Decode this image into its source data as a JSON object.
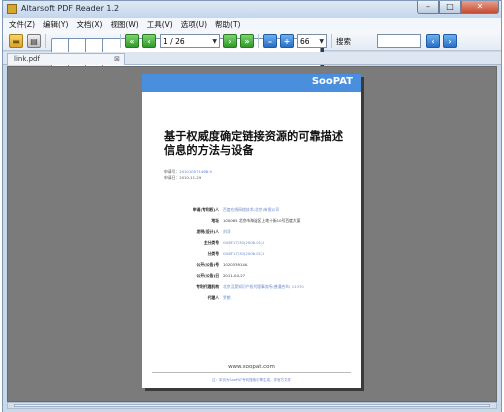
{
  "window": {
    "title": "Altarsoft PDF Reader 1.2",
    "min": "–",
    "max": "□",
    "close": "✕"
  },
  "menu": [
    "文件(Z)",
    "编辑(Y)",
    "文档(X)",
    "视图(W)",
    "工具(V)",
    "选项(U)",
    "帮助(T)"
  ],
  "toolbar": {
    "page_value": "1 / 26",
    "zoom_value": "66",
    "search_label": "搜索",
    "search_value": "",
    "icons": [
      "open-folder",
      "print",
      "single-page",
      "two-page",
      "fit-page",
      "export",
      "first-page",
      "prev-page",
      "next-page",
      "last-page",
      "zoom-out",
      "zoom-in",
      "search-prev",
      "search-next"
    ]
  },
  "tab": {
    "label": "link.pdf",
    "close": "⊠"
  },
  "document": {
    "brand": "SooPAT",
    "title": "基于权威度确定链接资源的可靠描述信息的方法与设备",
    "meta": [
      {
        "label": "申请号：",
        "value": "201010571468.9"
      },
      {
        "label": "申请日：",
        "value": "2010-11-29"
      }
    ],
    "fields": [
      {
        "label": "申请(专利权)人",
        "value": "百度在线网络技术(北京)有限公司"
      },
      {
        "label": "地址",
        "value": "100085 北京市海淀区上地十街10号百度大厦"
      },
      {
        "label": "发明(设计)人",
        "value": "刘洋"
      },
      {
        "label": "主分类号",
        "value": "G06F17/30(2006.01)I"
      },
      {
        "label": "分类号",
        "value": "G06F17/30(2006.01)I"
      },
      {
        "label": "公开(公告)号",
        "value": "102033914A"
      },
      {
        "label": "公开(公告)日",
        "value": "2011-04-27"
      },
      {
        "label": "专利代理机构",
        "value": "北京汉昊知识产权代理事务所(普通合伙) 11370"
      },
      {
        "label": "代理人",
        "value": "罗朗"
      }
    ],
    "url": "www.soopat.com",
    "footer": "注：本页为SooPAT专利搜索引擎生成，非官方文件"
  }
}
